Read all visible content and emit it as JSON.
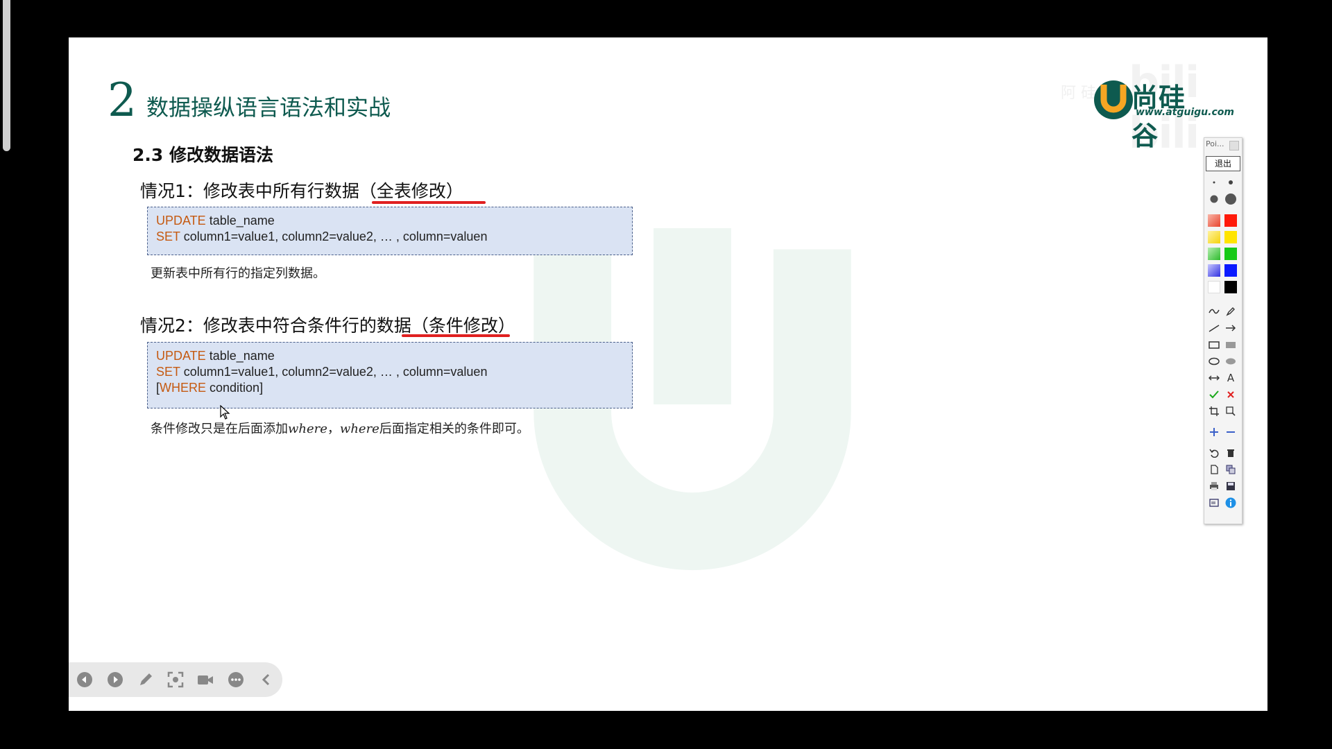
{
  "brand": {
    "logo_cn": "尚硅谷",
    "logo_url": "www.atguigu.com",
    "watermark_text": "bili bili",
    "watermark_small": "阿 硅谷"
  },
  "section": {
    "number": "2",
    "title": "数据操纵语言语法和实战"
  },
  "subsection": {
    "title": "2.3 修改数据语法"
  },
  "case1": {
    "heading": "情况1：修改表中所有行数据（全表修改）",
    "code": [
      {
        "kw": "UPDATE",
        "rest": " table_name"
      },
      {
        "kw": "SET",
        "rest": " column1=value1, column2=value2, … , column=valuen"
      }
    ],
    "note": "更新表中所有行的指定列数据。"
  },
  "case2": {
    "heading": "情况2：修改表中符合条件行的数据（条件修改）",
    "code": [
      {
        "kw": "UPDATE",
        "rest": " table_name"
      },
      {
        "kw": "SET",
        "rest": " column1=value1, column2=value2, … , column=valuen"
      },
      {
        "pre": "[",
        "kw": "WHERE",
        "rest": " condition]"
      }
    ],
    "note_a": "条件修改只是在后面添加",
    "note_w1": "where",
    "note_b": "，",
    "note_w2": "where",
    "note_c": "后面指定相关的条件即可。"
  },
  "toolbar": {
    "title": "Poi...",
    "exit": "退出",
    "text_tool": "A"
  },
  "colors": {
    "accent": "#0e5a4f",
    "keyword": "#c55a11",
    "code_bg": "#dae3f3",
    "underline": "#e02020"
  }
}
